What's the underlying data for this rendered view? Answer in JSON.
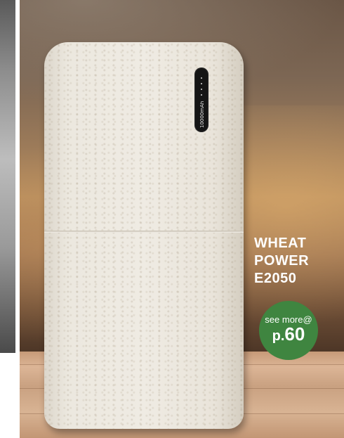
{
  "product": {
    "name_line1": "WHEAT",
    "name_line2": "POWER",
    "code": "E2050"
  },
  "device": {
    "capacity_label": "10000mAh"
  },
  "badge": {
    "see_more": "see more@",
    "page_prefix": "p.",
    "page_number": "60",
    "color": "#3f8540"
  }
}
